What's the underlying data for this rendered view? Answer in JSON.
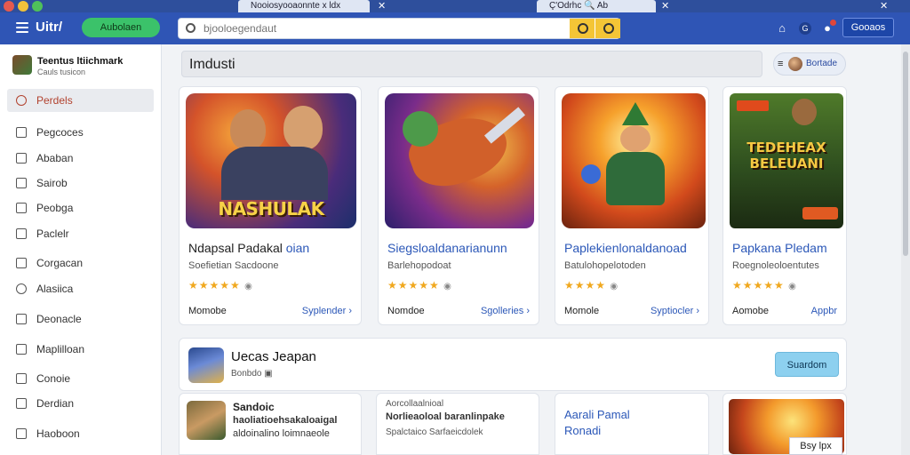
{
  "browser": {
    "tabs": [
      {
        "label": "Nooiosyooaonnte x ldx"
      },
      {
        "label": "Ç'Odrhc 🔍 Ab"
      }
    ]
  },
  "header": {
    "brand": "Uitr/",
    "brand_button": "Aubolaen",
    "search_placeholder": "bjooloegendaut",
    "cta": "Gooaos"
  },
  "sidebar": {
    "profile_name": "Teentus ltiichmark",
    "profile_sub": "Cauls tusicon",
    "items": [
      {
        "label": "Perdels",
        "icon": "person-icon"
      },
      {
        "label": "Pegcoces",
        "icon": "home-icon"
      },
      {
        "label": "Ababan",
        "icon": "image-icon"
      },
      {
        "label": "Sairob",
        "icon": "box-icon"
      },
      {
        "label": "Peobga",
        "icon": "puzzle-icon"
      },
      {
        "label": "Paclelr",
        "icon": "controller-icon"
      },
      {
        "label": "Corgacan",
        "icon": "pencil-icon"
      },
      {
        "label": "Alasiica",
        "icon": "clock-icon"
      },
      {
        "label": "Deonacle",
        "icon": "list-icon"
      },
      {
        "label": "Maplilloan",
        "icon": "grid-icon"
      },
      {
        "label": "Conoie",
        "icon": "home-icon"
      },
      {
        "label": "Derdian",
        "icon": "edit-icon"
      },
      {
        "label": "Haoboon",
        "icon": "image-icon"
      }
    ]
  },
  "main": {
    "section_title": "Imdusti",
    "user_pill": "Bortade",
    "cards": [
      {
        "art": "NASHULAK",
        "title": "Ndapsal Padakal",
        "tag": "oian",
        "sub": "Soefietian Sacdoone",
        "rating": "★★★★★",
        "foot_left": "Momobe",
        "foot_right": "Syplender ›"
      },
      {
        "art": "",
        "title": "Siegsloaldanarianunn",
        "tag": "",
        "sub": "Barlehopodoat",
        "rating": "★★★★★",
        "foot_left": "Nomdoe",
        "foot_right": "Sgolleries ›"
      },
      {
        "art": "",
        "title": "Paplekienlonaldanoad",
        "tag": "",
        "sub": "Batulohopelotoden",
        "rating": "★★★★",
        "foot_left": "Momole",
        "foot_right": "Syptiocler ›"
      },
      {
        "art": "TEDEHEAX BELEUANI",
        "title": "Papkana Pledam",
        "tag": "",
        "sub": "Roegnoleoloentutes",
        "rating": "★★★★★",
        "foot_left": "Aomobe",
        "foot_right": "Appbr"
      }
    ],
    "featured": {
      "title": "Uecas Jeapan",
      "sub": "Bonbdo",
      "button": "Suardom"
    },
    "minis": [
      {
        "title": "Sandoic",
        "line1": "haoliatioehsakaloaigal",
        "line2": "aldoinalino loimnaeole"
      },
      {
        "title": "Aorcollaalnioal",
        "line1": "Norlieaoloal baranlinpake",
        "line2": "Spalctaico Sarfaeicdolek"
      },
      {
        "title": "Aarali Pamal",
        "line1": "Ronadi",
        "line2": ""
      }
    ],
    "mini_badge": "Bsy lpx"
  }
}
